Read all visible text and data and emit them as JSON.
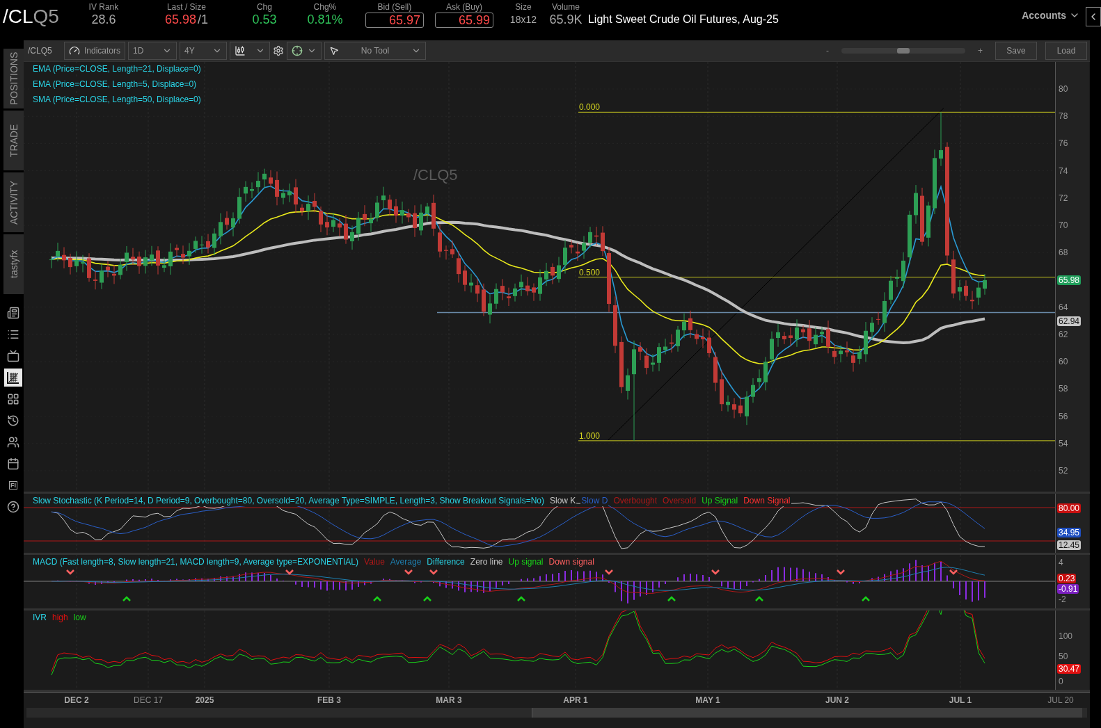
{
  "quote": {
    "symbol_prefix": "/CL",
    "symbol_suffix": "Q5",
    "fields": [
      {
        "label": "IV Rank",
        "value": "28.6",
        "kind": "plain",
        "color": "#aaaaaa"
      },
      {
        "label": "Last / Size",
        "value": "65.98",
        "size": "/1",
        "kind": "plain",
        "color": "#ff4a4a"
      },
      {
        "label": "Chg",
        "value": "0.53",
        "kind": "plain",
        "color": "#2fc45a"
      },
      {
        "label": "Chg%",
        "value": "0.81%",
        "kind": "plain",
        "color": "#2fc45a"
      },
      {
        "label": "Bid (Sell)",
        "value": "65.97",
        "kind": "box",
        "color": "#ff4a4a"
      },
      {
        "label": "Ask (Buy)",
        "value": "65.99",
        "kind": "box",
        "color": "#ff4a4a"
      },
      {
        "label": "Size",
        "value": "18x12",
        "kind": "small",
        "color": "#aaaaaa"
      },
      {
        "label": "Volume",
        "value": "65.9K",
        "kind": "plain",
        "color": "#aaaaaa"
      }
    ],
    "description": "Light Sweet Crude Oil Futures, Aug-25",
    "accounts": "Accounts"
  },
  "sidebar": {
    "tabs": [
      "POSITIONS",
      "TRADE",
      "ACTIVITY",
      "tastyfx"
    ],
    "icons": [
      {
        "kind": "news",
        "selected": false
      },
      {
        "kind": "list",
        "selected": false
      },
      {
        "kind": "tv",
        "selected": false
      },
      {
        "kind": "chart",
        "selected": true
      },
      {
        "kind": "tiles",
        "selected": false
      },
      {
        "kind": "history",
        "selected": false
      },
      {
        "kind": "people",
        "selected": false
      },
      {
        "kind": "calendar",
        "selected": false
      },
      {
        "kind": "label",
        "label": "FI",
        "selected": false
      },
      {
        "kind": "help",
        "selected": false
      }
    ]
  },
  "toolbar": {
    "symbol": "/CLQ5",
    "indicators": "Indicators",
    "aggregation": "1D",
    "range": "4Y",
    "drawing_tool": "No Tool",
    "zoom_out": "-",
    "zoom_in": "+",
    "zoom": {
      "level": 0.5
    },
    "save": "Save",
    "load": "Load"
  },
  "price_chart": {
    "studies": [
      {
        "label": "EMA (Price=CLOSE, Length=21, Displace=0)"
      },
      {
        "label": "EMA (Price=CLOSE, Length=5, Displace=0)"
      },
      {
        "label": "SMA (Price=CLOSE, Length=50, Displace=0)"
      }
    ],
    "watermark": "/CLQ5",
    "fib_labels": [
      "0.000",
      "0.500",
      "1.000"
    ],
    "axis": [
      "80",
      "78",
      "76",
      "74",
      "72",
      "70",
      "68",
      "64",
      "62",
      "60",
      "58",
      "56",
      "54",
      "52"
    ],
    "badges": [
      {
        "value": "65.98",
        "color": "#1f9e5a"
      },
      {
        "value": "62.94",
        "color": "#c8c8c8"
      }
    ]
  },
  "stochastic": {
    "title": "Slow Stochastic (K Period=14, D Period=9, Overbought=80, Oversold=20, Average Type=SIMPLE, Length=3, Show Breakout Signals=No)",
    "legend": [
      {
        "label": "Slow K",
        "color": "#c8c8c8"
      },
      {
        "label": "Slow D",
        "color": "#2a5fc9"
      },
      {
        "label": "Overbought",
        "color": "#b01818"
      },
      {
        "label": "Oversold",
        "color": "#b01818"
      },
      {
        "label": "Up Signal",
        "color": "#19d119"
      },
      {
        "label": "Down Signal",
        "color": "#ff3030"
      }
    ],
    "badges": [
      {
        "value": "80.00",
        "color": "#c80f0f"
      },
      {
        "value": "34.95",
        "color": "#1f4fc0"
      },
      {
        "value": "12.45",
        "color": "#c8c8c8"
      }
    ]
  },
  "macd": {
    "title": "MACD (Fast length=8, Slow length=21, MACD length=9, Average type=EXPONENTIAL)",
    "legend": [
      {
        "label": "Value",
        "color": "#b01818"
      },
      {
        "label": "Average",
        "color": "#1e7fb0"
      },
      {
        "label": "Difference",
        "color": "#2ad4e6"
      },
      {
        "label": "Zero line",
        "color": "#c8c8c8"
      },
      {
        "label": "Up signal",
        "color": "#19d119"
      },
      {
        "label": "Down signal",
        "color": "#ff6060"
      }
    ],
    "axis": [
      "4",
      "-2"
    ],
    "badges": [
      {
        "value": "0.23",
        "color": "#c80f0f"
      },
      {
        "value": "-0.91",
        "color": "#7a1fc0"
      }
    ]
  },
  "ivr": {
    "title": "IVR",
    "legend": [
      {
        "label": "high",
        "color": "#e01010"
      },
      {
        "label": "low",
        "color": "#19d119"
      }
    ],
    "axis": [
      "100",
      "50",
      "0"
    ],
    "badges": [
      {
        "value": "30.47",
        "color": "#e01010"
      }
    ]
  },
  "time_axis": [
    {
      "label": "DEC 2",
      "major": true
    },
    {
      "label": "DEC 17",
      "major": false
    },
    {
      "label": "2025",
      "major": true
    },
    {
      "label": "FEB 3",
      "major": true
    },
    {
      "label": "MAR 3",
      "major": true
    },
    {
      "label": "APR 1",
      "major": true
    },
    {
      "label": "MAY 1",
      "major": true
    },
    {
      "label": "JUN 2",
      "major": true
    },
    {
      "label": "JUL 1",
      "major": true
    },
    {
      "label": "JUL 20",
      "major": false
    }
  ]
}
